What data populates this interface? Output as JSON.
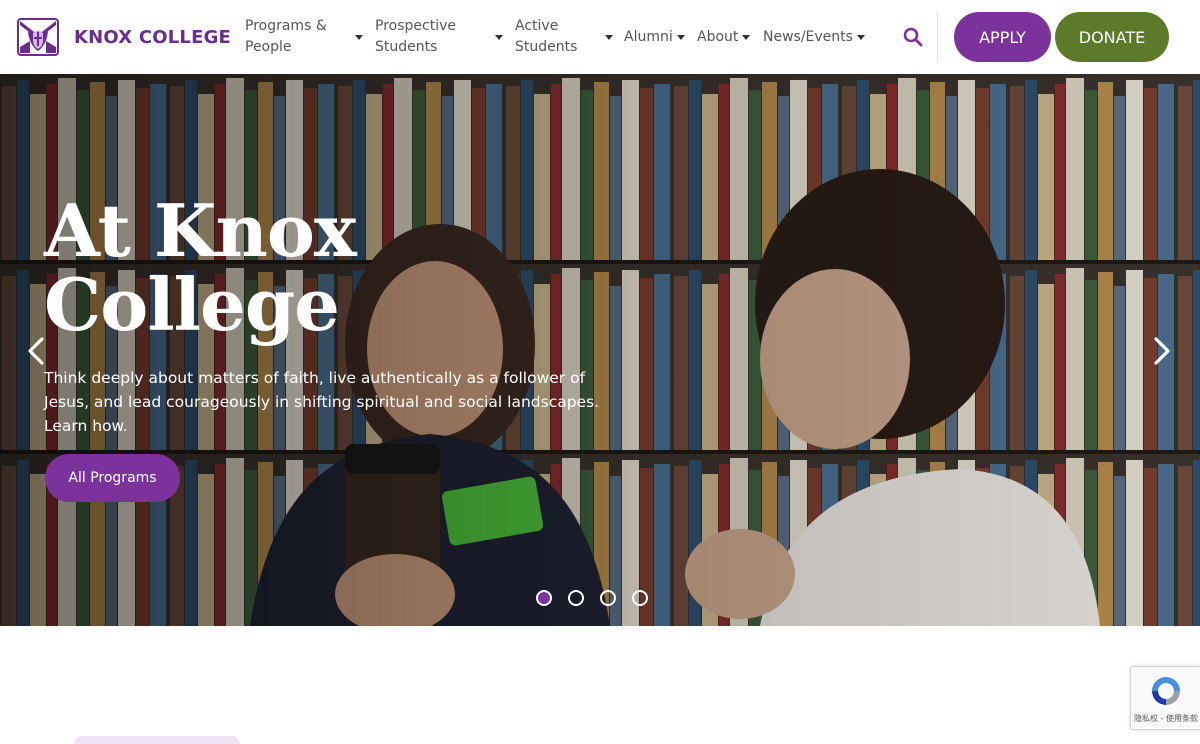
{
  "header": {
    "brand": "KNOX COLLEGE",
    "nav": [
      {
        "label": "Programs & People"
      },
      {
        "label": "Prospective Students"
      },
      {
        "label": "Active Students"
      },
      {
        "label": "Alumni"
      },
      {
        "label": "About"
      },
      {
        "label": "News/Events"
      }
    ],
    "apply_label": "APPLY",
    "donate_label": "DONATE"
  },
  "hero": {
    "title": "At Knox College",
    "text": "Think deeply about matters of faith, live authentically as a follower of Jesus, and lead courageously in shifting spiritual and social landscapes. Learn how.",
    "cta_label": "All Programs",
    "slide_count": 4,
    "active_slide": 1
  },
  "recaptcha": {
    "text": "隐私权 - 使用条款"
  },
  "colors": {
    "brand_purple": "#7b329c",
    "donate_green": "#5b7b2a",
    "logo_purple": "#6a2c91",
    "nav_text": "#555555"
  },
  "icons": {
    "search": "search-icon",
    "prev": "chevron-left-icon",
    "next": "chevron-right-icon",
    "caret": "caret-down-icon"
  }
}
